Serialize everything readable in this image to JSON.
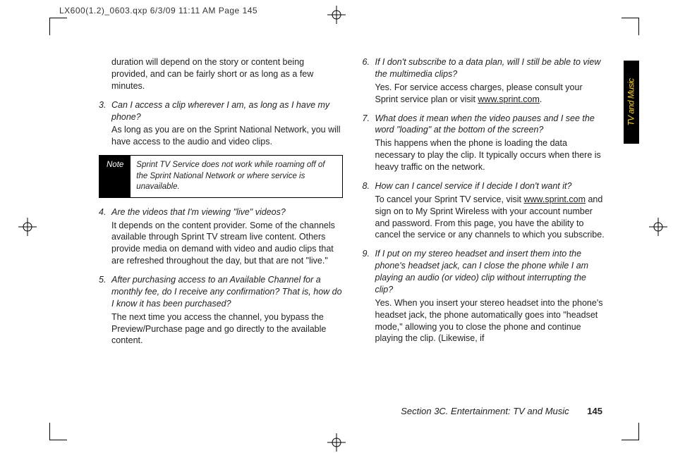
{
  "header": "LX600(1.2)_0603.qxp  6/3/09  11:11 AM  Page 145",
  "side_tab": "TV and Music",
  "col1": {
    "lead_answer": "duration will depend on the story or content being provided, and can be fairly short or as long as a few minutes.",
    "q3_num": "3.",
    "q3": "Can I access a clip wherever I am, as long as I have my phone?",
    "a3": "As long as you are on the Sprint National Network, you will have access to the audio and video clips.",
    "note_label": "Note",
    "note_text": "Sprint TV Service does not work while roaming off of the Sprint National Network or where service is unavailable.",
    "q4_num": "4.",
    "q4": "Are the videos that I'm viewing \"live\" videos?",
    "a4": "It depends on the content provider. Some of the channels available through Sprint TV stream live content. Others provide media on demand with video and audio clips that are refreshed throughout the day, but that are not \"live.\"",
    "q5_num": "5.",
    "q5": "After purchasing access to an Available Channel for a monthly fee, do I receive any confirmation? That is, how do I know it has been purchased?",
    "a5": "The next time you access the channel, you bypass the Preview/Purchase page and go directly to the available content."
  },
  "col2": {
    "q6_num": "6.",
    "q6": "If I don't subscribe to a data plan, will I still be able to view the multimedia clips?",
    "a6_pre": "Yes. For service access charges, please consult your Sprint service plan or visit ",
    "a6_link": "www.sprint.com",
    "a6_post": ".",
    "q7_num": "7.",
    "q7": "What does it mean when the video pauses and I see the word \"loading\" at the bottom of the screen?",
    "a7": "This happens when the phone is loading the data necessary to play the clip. It typically occurs when there is heavy traffic on the network.",
    "q8_num": "8.",
    "q8": "How can I cancel service if I decide I don't want it?",
    "a8_pre": "To cancel your Sprint TV service, visit ",
    "a8_link": "www.sprint.com",
    "a8_post": " and sign on to My Sprint Wireless with your account number and password. From this page, you have the ability to cancel the service or any channels to which you subscribe.",
    "q9_num": "9.",
    "q9": "If I put on my stereo headset and insert them into the phone's headset jack, can I close the phone while I am playing an audio (or video) clip without interrupting the clip?",
    "a9": "Yes. When you insert your stereo headset into the phone's headset jack, the phone automatically goes into \"headset mode,\" allowing you to close the phone and continue playing the clip. (Likewise, if"
  },
  "footer": {
    "section": "Section 3C. Entertainment: TV and Music",
    "page": "145"
  }
}
